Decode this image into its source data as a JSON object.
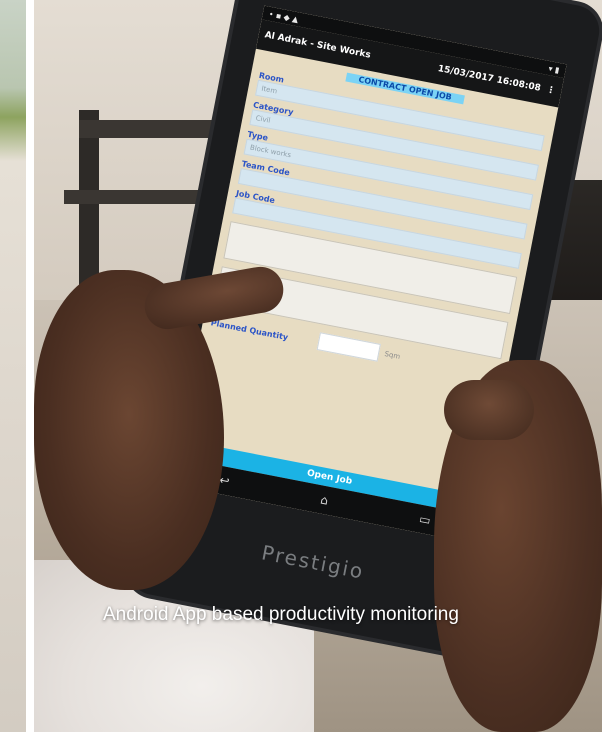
{
  "caption": "Android App based productivity monitoring",
  "tablet": {
    "brand": "Prestigio",
    "app_title": "Al Adrak - Site Works",
    "datetime": "15/03/2017 16:08:08",
    "screen_title": "CONTRACT OPEN JOB",
    "fields": [
      {
        "label": "Room",
        "value": "Item"
      },
      {
        "label": "Category",
        "value": "Civil"
      },
      {
        "label": "Type",
        "value": "Block works"
      },
      {
        "label": "Team Code",
        "value": ""
      },
      {
        "label": "Job Code",
        "value": ""
      }
    ],
    "planned_quantity_label": "Planned Quantity",
    "unit": "Sqm",
    "open_job_button": "Open Job"
  },
  "colors": {
    "screen_bg": "#e7dcc2",
    "button_accent": "#1bb3e5",
    "label_blue": "#2c55c7"
  }
}
